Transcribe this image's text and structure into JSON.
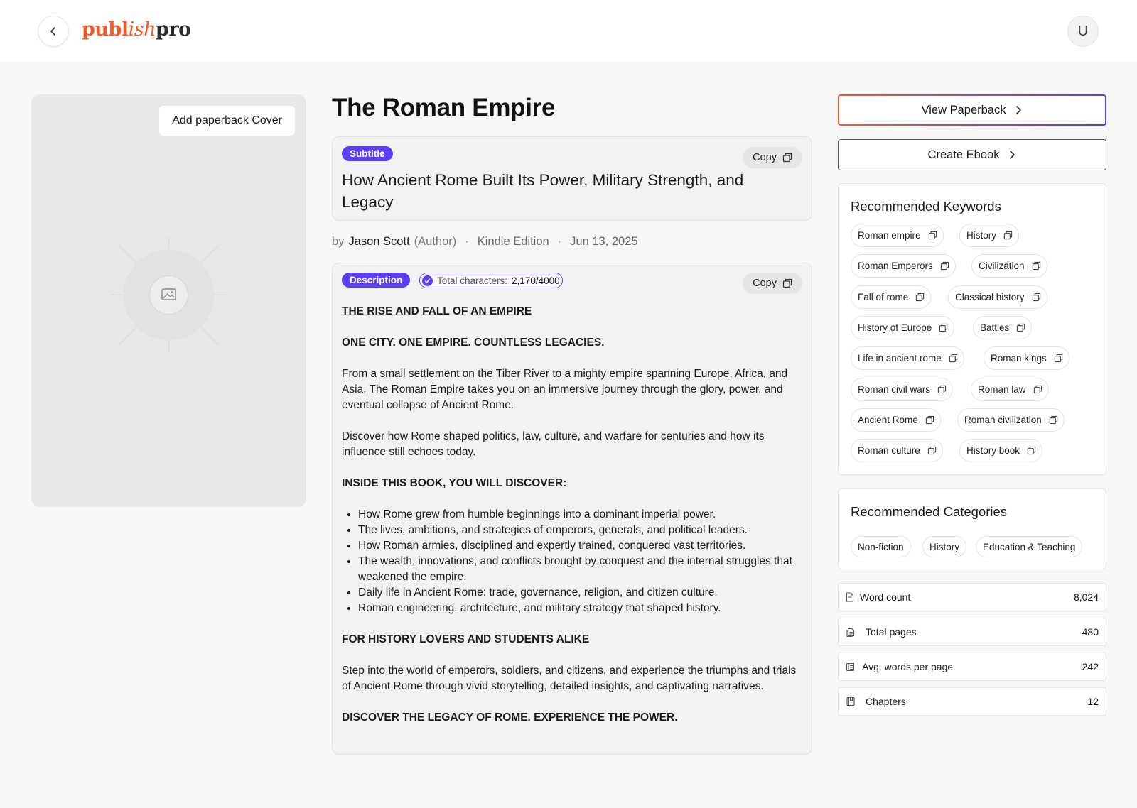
{
  "header": {
    "logo": {
      "part1": "publ",
      "part2": "ish",
      "part3": "pro"
    },
    "avatar_initial": "U",
    "icons": {
      "back": "chevron-left-icon"
    }
  },
  "cover": {
    "add_cover_label": "Add paperback Cover",
    "placeholder_icon": "image-icon"
  },
  "book": {
    "title": "The Roman Empire",
    "subtitle_tag": "Subtitle",
    "subtitle": "How Ancient Rome Built Its Power, Military Strength, and Legacy",
    "copy_label": "Copy",
    "byline": {
      "prefix": "by",
      "author": "Jason Scott",
      "role": "(Author)",
      "edition": "Kindle Edition",
      "date": "Jun 13, 2025",
      "separator": "·"
    },
    "description_tag": "Description",
    "char_count_label": "Total characters:",
    "char_count_value": "2,170/4000",
    "description": {
      "heading1": "THE RISE AND FALL OF AN EMPIRE",
      "heading2": "ONE CITY. ONE EMPIRE. COUNTLESS LEGACIES.",
      "para1": "From a small settlement on the Tiber River to a mighty empire spanning Europe, Africa, and Asia, The Roman Empire takes you on an immersive journey through the glory, power, and eventual collapse of Ancient Rome.",
      "para2": "Discover how Rome shaped politics, law, culture, and warfare for centuries and how its influence still echoes today.",
      "heading3": "INSIDE THIS BOOK, YOU WILL DISCOVER:",
      "bullets": [
        "How Rome grew from humble beginnings into a dominant imperial power.",
        "The lives, ambitions, and strategies of emperors, generals, and political leaders.",
        "How Roman armies, disciplined and expertly trained, conquered vast territories.",
        "The wealth, innovations, and conflicts brought by conquest and the internal struggles that weakened the empire.",
        "Daily life in Ancient Rome: trade, governance, religion, and citizen culture.",
        "Roman engineering, architecture, and military strategy that shaped history."
      ],
      "heading4": "FOR HISTORY LOVERS AND STUDENTS ALIKE",
      "para3": "Step into the world of emperors, soldiers, and citizens, and experience the triumphs and trials of Ancient Rome through vivid storytelling, detailed insights, and captivating narratives.",
      "heading5": "DISCOVER THE LEGACY OF ROME. EXPERIENCE THE POWER."
    }
  },
  "actions": {
    "view_paperback": "View Paperback",
    "create_ebook": "Create Ebook"
  },
  "keywords": {
    "title": "Recommended Keywords",
    "items": [
      "Roman empire",
      "History",
      "Roman Emperors",
      "Civilization",
      "Fall of rome",
      "Classical history",
      "History of Europe",
      "Battles",
      "Life in ancient rome",
      "Roman kings",
      "Roman civil wars",
      "Roman law",
      "Ancient Rome",
      "Roman civilization",
      "Roman culture",
      "History book"
    ]
  },
  "categories": {
    "title": "Recommended Categories",
    "items": [
      "Non-fiction",
      "History",
      "Education & Teaching"
    ]
  },
  "stats": [
    {
      "label": "Word count",
      "value": "8,024",
      "icon": "document-icon"
    },
    {
      "label": "Total pages",
      "value": "480",
      "icon": "pages-icon"
    },
    {
      "label": "Avg. words per page",
      "value": "242",
      "icon": "list-icon"
    },
    {
      "label": "Chapters",
      "value": "12",
      "icon": "book-icon"
    }
  ],
  "colors": {
    "accent": "#5b3ff5",
    "brand": "#f15a24"
  }
}
